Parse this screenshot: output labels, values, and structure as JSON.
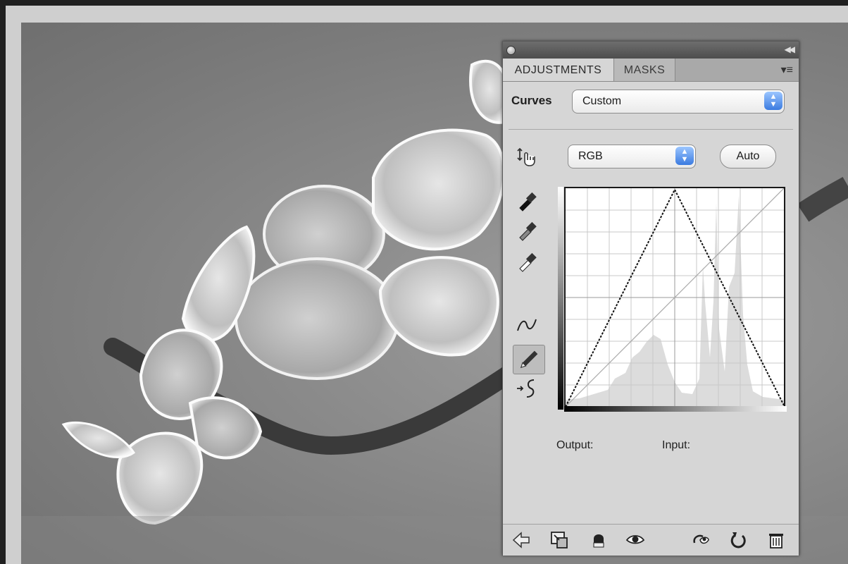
{
  "panel": {
    "tabs": [
      "ADJUSTMENTS",
      "MASKS"
    ],
    "active_tab": "ADJUSTMENTS",
    "adjustment_type": "Curves",
    "preset_value": "Custom",
    "channel_value": "RGB",
    "auto_label": "Auto",
    "output_label": "Output:",
    "input_label": "Input:"
  },
  "icons": {
    "tools": [
      "on-image-adjust-icon",
      "black-point-eyedropper-icon",
      "gray-point-eyedropper-icon",
      "white-point-eyedropper-icon",
      "curve-point-icon",
      "pencil-draw-icon",
      "smooth-curve-icon"
    ],
    "bottom": [
      "back-arrow-icon",
      "expand-view-icon",
      "clip-to-layer-icon",
      "visibility-eye-icon",
      "previous-state-icon",
      "reset-icon",
      "trash-icon"
    ]
  },
  "colors": {
    "panel_bg": "#d6d6d6",
    "select_arrow": "#3b7be0"
  }
}
